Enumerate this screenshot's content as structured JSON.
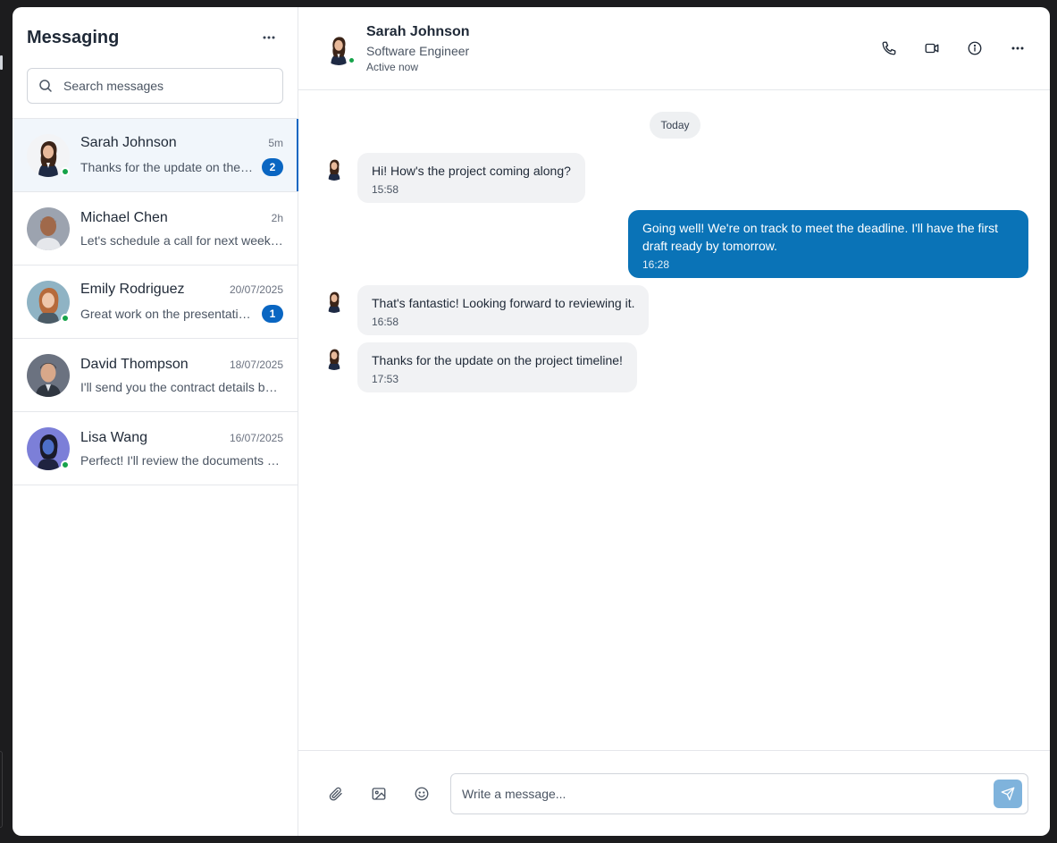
{
  "sidebar": {
    "title": "Messaging",
    "more_icon": "ellipsis-horizontal-icon",
    "search": {
      "placeholder": "Search messages",
      "value": "",
      "icon": "search-icon"
    },
    "conversations": [
      {
        "name": "Sarah Johnson",
        "time": "5m",
        "preview": "Thanks for the update on the project timeline!",
        "unread": "2",
        "online": true,
        "active": true
      },
      {
        "name": "Michael Chen",
        "time": "2h",
        "preview": "Let's schedule a call for next week to discuss the proposal",
        "unread": "",
        "online": false,
        "active": false
      },
      {
        "name": "Emily Rodriguez",
        "time": "20/07/2025",
        "preview": "Great work on the presentation yesterday!",
        "unread": "1",
        "online": true,
        "active": false
      },
      {
        "name": "David Thompson",
        "time": "18/07/2025",
        "preview": "I'll send you the contract details by tomorrow",
        "unread": "",
        "online": false,
        "active": false
      },
      {
        "name": "Lisa Wang",
        "time": "16/07/2025",
        "preview": "Perfect! I'll review the documents and get back to you",
        "unread": "",
        "online": true,
        "active": false
      }
    ]
  },
  "chat": {
    "contact": {
      "name": "Sarah Johnson",
      "role": "Software Engineer",
      "status": "Active now"
    },
    "actions": [
      "phone-icon",
      "video-icon",
      "info-icon",
      "ellipsis-horizontal-icon"
    ],
    "date_label": "Today",
    "messages": [
      {
        "direction": "in",
        "text": "Hi! How's the project coming along?",
        "time": "15:58"
      },
      {
        "direction": "out",
        "text": "Going well! We're on track to meet the deadline. I'll have the first draft ready by tomorrow.",
        "time": "16:28"
      },
      {
        "direction": "in",
        "text": "That's fantastic! Looking forward to reviewing it.",
        "time": "16:58"
      },
      {
        "direction": "in",
        "text": "Thanks for the update on the project timeline!",
        "time": "17:53"
      }
    ],
    "composer": {
      "placeholder": "Write a message...",
      "value": "",
      "tools": [
        "paperclip-icon",
        "image-icon",
        "emoji-icon"
      ],
      "send_icon": "send-icon"
    }
  },
  "colors": {
    "accent": "#0a66c2",
    "outgoing_bubble": "#0a73b7",
    "incoming_bubble": "#f1f2f4",
    "online": "#16a34a",
    "send_button": "#7fb3dc"
  }
}
